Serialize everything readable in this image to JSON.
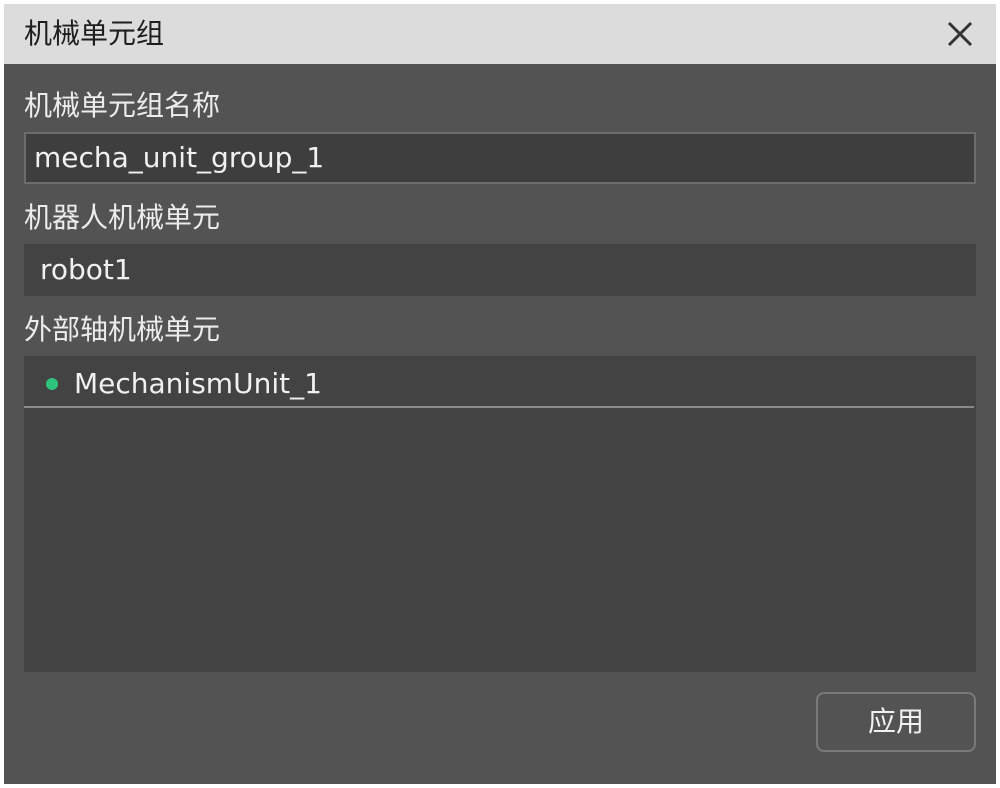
{
  "window": {
    "title": "机械单元组"
  },
  "icons": {
    "close": "close-icon",
    "status": "status-dot-icon"
  },
  "colors": {
    "titlebar_bg": "#dcdcdc",
    "panel_bg": "#535353",
    "field_bg": "#414141",
    "status_ok": "#2fc27a"
  },
  "form": {
    "group_name_label": "机械单元组名称",
    "group_name_value": "mecha_unit_group_1",
    "robot_unit_label": "机器人机械单元",
    "robot_unit_value": "robot1",
    "external_axis_label": "外部轴机械单元",
    "external_axis_items": [
      {
        "label": "MechanismUnit_1"
      }
    ]
  },
  "actions": {
    "apply_label": "应用"
  }
}
